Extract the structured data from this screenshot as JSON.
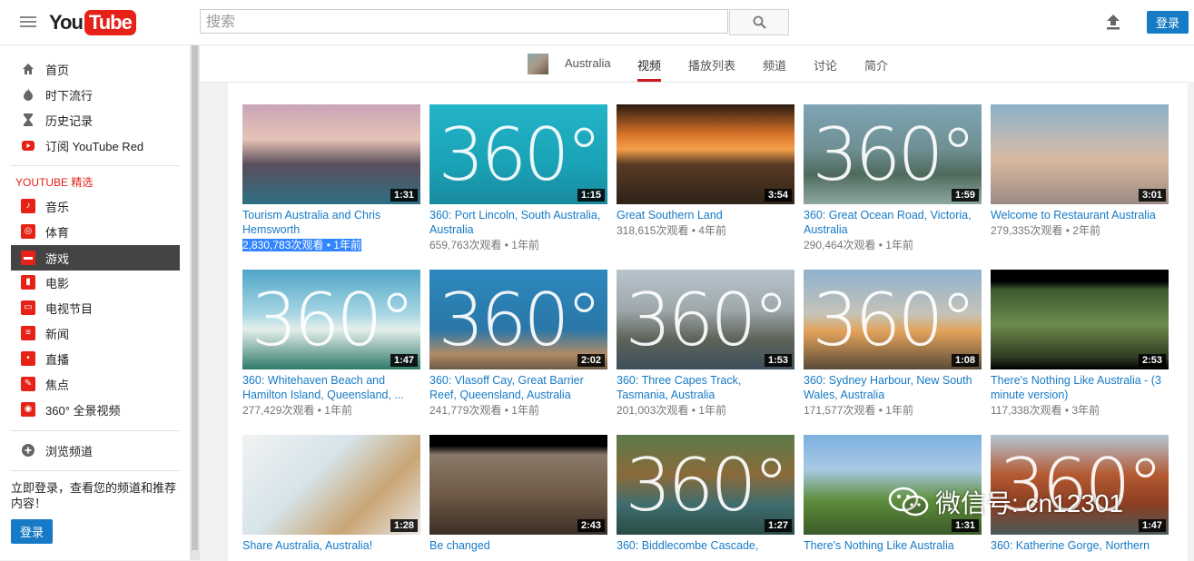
{
  "header": {
    "logo_you": "You",
    "logo_tube": "Tube",
    "search_placeholder": "搜索",
    "login": "登录"
  },
  "sidebar": {
    "items": [
      {
        "label": "首页",
        "icon": "home-icon"
      },
      {
        "label": "时下流行",
        "icon": "flame-icon"
      },
      {
        "label": "历史记录",
        "icon": "hourglass-icon"
      },
      {
        "label": "订阅 YouTube Red",
        "icon": "youtube-red-icon"
      }
    ],
    "section_title": "YOUTUBE 精选",
    "channels": [
      {
        "label": "音乐",
        "icon": "music-icon"
      },
      {
        "label": "体育",
        "icon": "sports-icon"
      },
      {
        "label": "游戏",
        "icon": "gaming-icon"
      },
      {
        "label": "电影",
        "icon": "film-icon"
      },
      {
        "label": "电视节目",
        "icon": "tv-icon"
      },
      {
        "label": "新闻",
        "icon": "news-icon"
      },
      {
        "label": "直播",
        "icon": "live-icon"
      },
      {
        "label": "焦点",
        "icon": "spotlight-icon"
      },
      {
        "label": "360° 全景视频",
        "icon": "360-video-icon"
      }
    ],
    "browse": "浏览频道",
    "prompt": "立即登录，查看您的频道和推荐内容！",
    "login": "登录"
  },
  "channel_nav": {
    "name": "Australia",
    "tabs": [
      "视频",
      "播放列表",
      "频道",
      "讨论",
      "简介"
    ],
    "active_tab": "视频"
  },
  "videos": [
    {
      "title": "Tourism Australia and Chris Hemsworth",
      "views": "2,830,783次观看",
      "age": "1年前",
      "duration": "1:31"
    },
    {
      "title": "360: Port Lincoln, South Australia, Australia",
      "views": "659,763次观看",
      "age": "1年前",
      "duration": "1:15"
    },
    {
      "title": "Great Southern Land",
      "views": "318,615次观看",
      "age": "4年前",
      "duration": "3:54"
    },
    {
      "title": "360: Great Ocean Road, Victoria, Australia",
      "views": "290,464次观看",
      "age": "1年前",
      "duration": "1:59"
    },
    {
      "title": "Welcome to Restaurant Australia",
      "views": "279,335次观看",
      "age": "2年前",
      "duration": "3:01"
    },
    {
      "title": "360: Whitehaven Beach and Hamilton Island, Queensland, ...",
      "views": "277,429次观看",
      "age": "1年前",
      "duration": "1:47"
    },
    {
      "title": "360: Vlasoff Cay, Great Barrier Reef, Queensland, Australia",
      "views": "241,779次观看",
      "age": "1年前",
      "duration": "2:02"
    },
    {
      "title": "360: Three Capes Track, Tasmania, Australia",
      "views": "201,003次观看",
      "age": "1年前",
      "duration": "1:53"
    },
    {
      "title": "360: Sydney Harbour, New South Wales, Australia",
      "views": "171,577次观看",
      "age": "1年前",
      "duration": "1:08"
    },
    {
      "title": "There's Nothing Like Australia - (3 minute version)",
      "views": "117,338次观看",
      "age": "3年前",
      "duration": "2:53"
    },
    {
      "title": "Share Australia, Australia!",
      "views": "",
      "age": "",
      "duration": "1:28"
    },
    {
      "title": "Be changed",
      "views": "",
      "age": "",
      "duration": "2:43"
    },
    {
      "title": "360: Biddlecombe Cascade,",
      "views": "",
      "age": "",
      "duration": "1:27"
    },
    {
      "title": "There's Nothing Like Australia",
      "views": "",
      "age": "",
      "duration": "1:31"
    },
    {
      "title": "360: Katherine Gorge, Northern",
      "views": "",
      "age": "",
      "duration": "1:47"
    }
  ],
  "thumb_360_text": "360°",
  "separator": "•",
  "watermark": "微信号: cn12301"
}
